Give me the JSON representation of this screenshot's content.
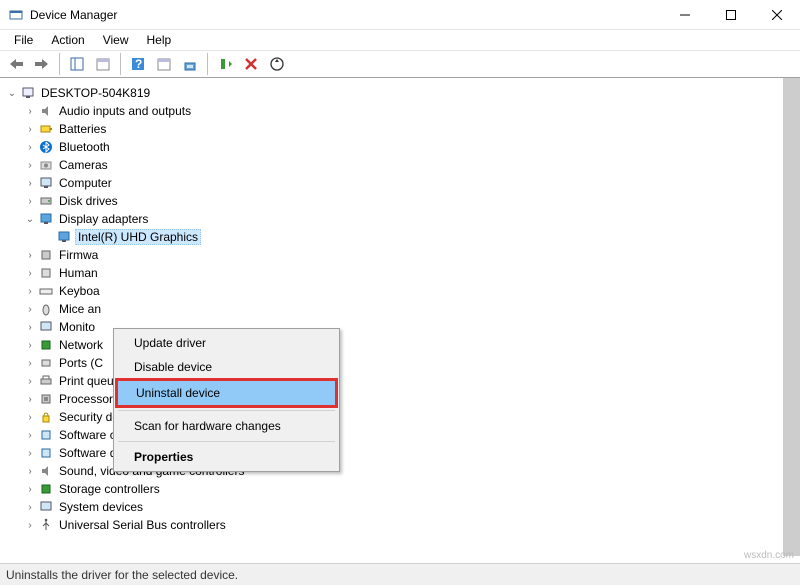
{
  "window": {
    "title": "Device Manager"
  },
  "menu": {
    "file": "File",
    "action": "Action",
    "view": "View",
    "help": "Help"
  },
  "tree": {
    "root": "DESKTOP-504K819",
    "items": [
      "Audio inputs and outputs",
      "Batteries",
      "Bluetooth",
      "Cameras",
      "Computer",
      "Disk drives",
      "Display adapters",
      "Intel(R) UHD Graphics",
      "Firmwa",
      "Human",
      "Keyboa",
      "Mice an",
      "Monito",
      "Network",
      "Ports (C",
      "Print queues",
      "Processors",
      "Security devices",
      "Software components",
      "Software devices",
      "Sound, video and game controllers",
      "Storage controllers",
      "System devices",
      "Universal Serial Bus controllers"
    ]
  },
  "context_menu": {
    "update": "Update driver",
    "disable": "Disable device",
    "uninstall": "Uninstall device",
    "scan": "Scan for hardware changes",
    "properties": "Properties"
  },
  "status": "Uninstalls the driver for the selected device.",
  "watermark": "wsxdn.com"
}
